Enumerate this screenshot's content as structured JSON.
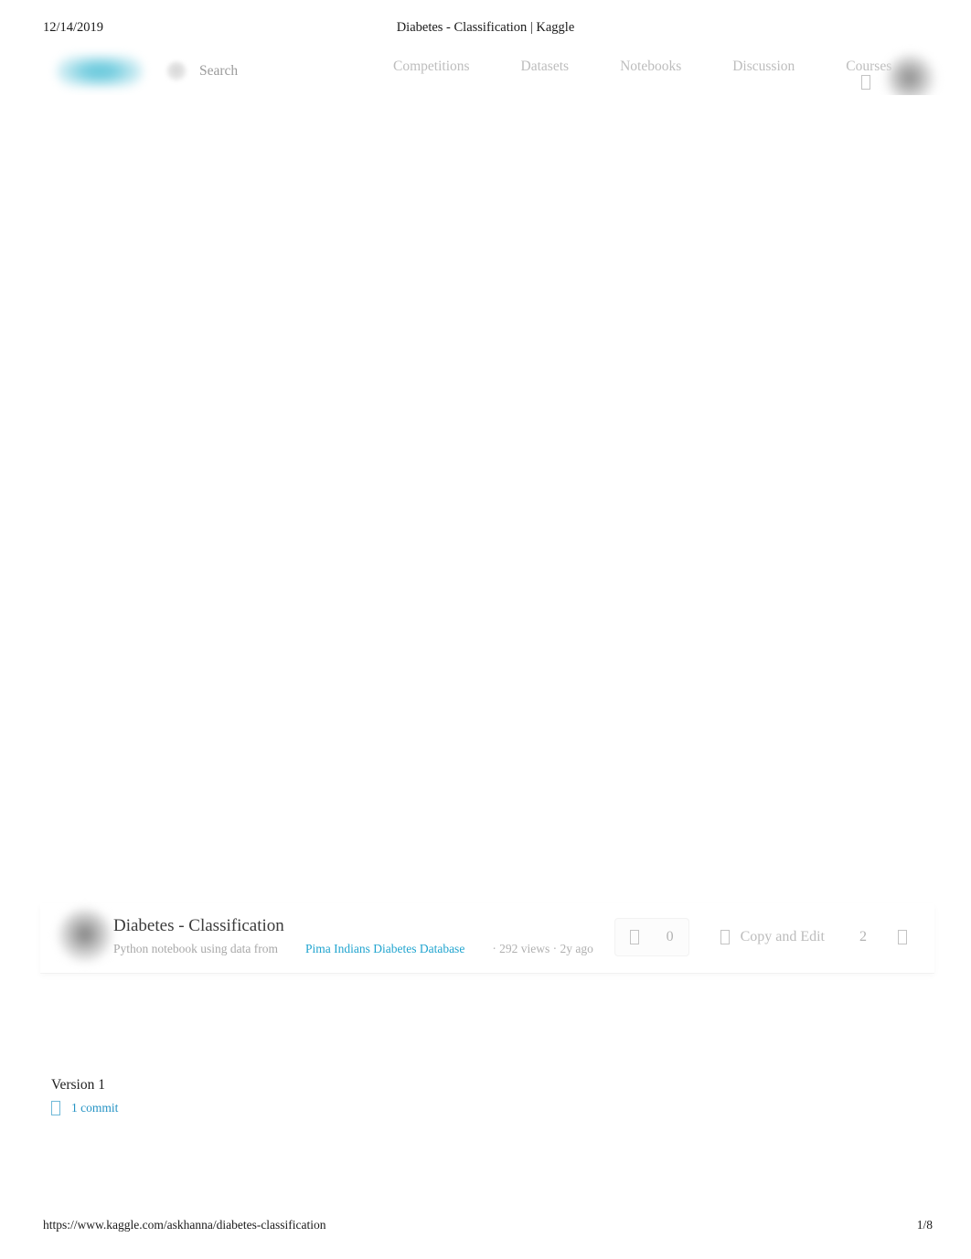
{
  "print": {
    "date": "12/14/2019",
    "document_title": "Diabetes - Classification | Kaggle",
    "footer_url": "https://www.kaggle.com/askhanna/diabetes-classification",
    "page_indicator": "1/8"
  },
  "nav": {
    "logo_name": "kaggle-logo",
    "search": {
      "icon": "search-icon",
      "placeholder": "Search",
      "value": ""
    },
    "links": [
      {
        "label": "Competitions"
      },
      {
        "label": "Datasets"
      },
      {
        "label": "Notebooks"
      },
      {
        "label": "Discussion"
      },
      {
        "label": "Courses"
      }
    ],
    "notifications_icon": "bell-icon",
    "avatar": "user-avatar"
  },
  "notebook": {
    "thumbnail": "notebook-author-avatar",
    "title": "Diabetes - Classification",
    "subtitle": "Python notebook using data from",
    "dataset_link": "Pima Indians Diabetes Database",
    "meta": "· 292 views · 2y ago",
    "actions": {
      "upvote_icon": "upvote-arrow-icon",
      "vote_count": "0",
      "copy_icon": "copy-icon",
      "copy_label": "Copy and Edit",
      "fork_count": "2",
      "more_icon": "ellipsis-icon"
    }
  },
  "version": {
    "label": "Version 1",
    "commit_icon": "commit-branch-icon",
    "commit_link": "1 commit"
  },
  "colors": {
    "link_blue": "#2593c4",
    "dataset_link": "#20a4cf",
    "muted_text": "#b3b3b3",
    "body_text": "#1a1a1a",
    "background": "#ffffff"
  }
}
